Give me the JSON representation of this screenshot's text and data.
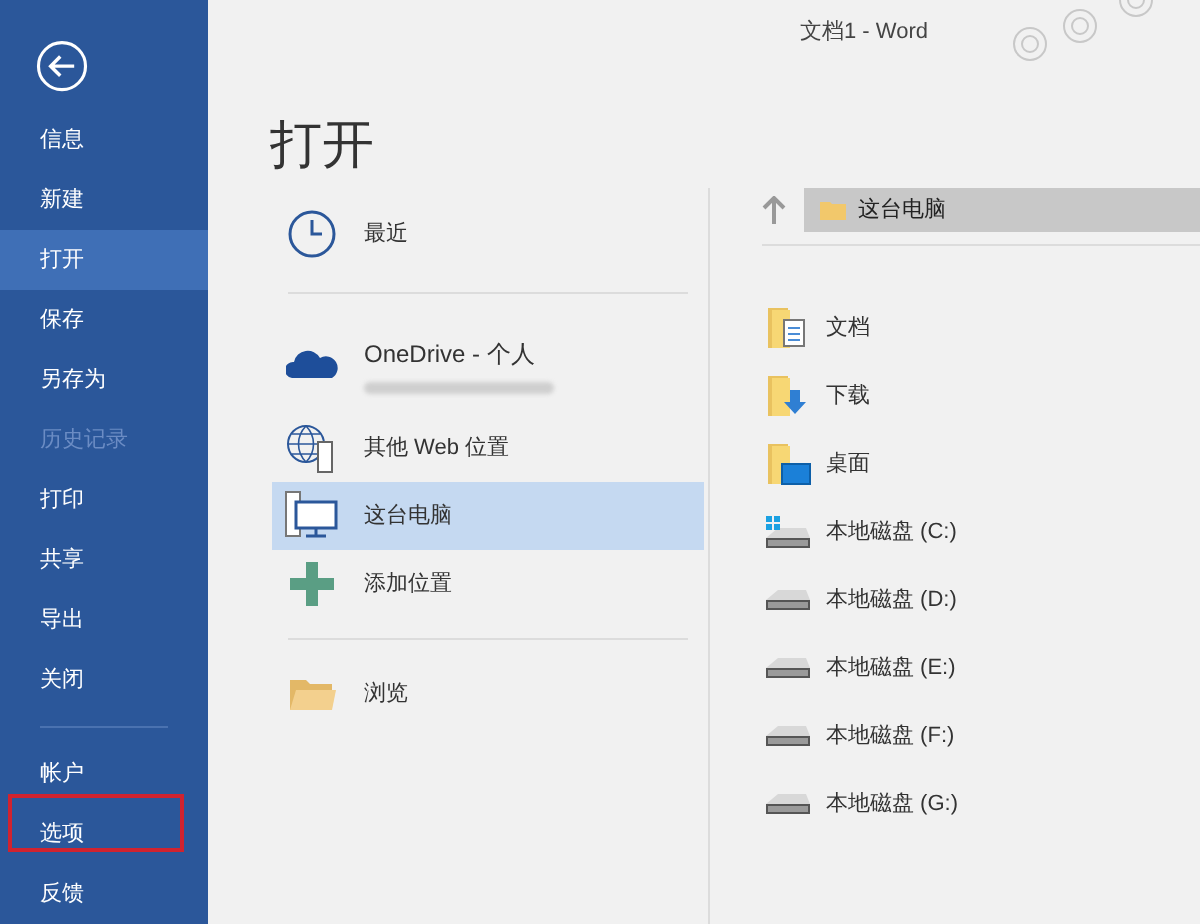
{
  "window": {
    "title": "文档1 - Word"
  },
  "sidebar": {
    "items": [
      {
        "label": "信息",
        "selected": false,
        "disabled": false,
        "outlined": false
      },
      {
        "label": "新建",
        "selected": false,
        "disabled": false,
        "outlined": false
      },
      {
        "label": "打开",
        "selected": true,
        "disabled": false,
        "outlined": false
      },
      {
        "label": "保存",
        "selected": false,
        "disabled": false,
        "outlined": false
      },
      {
        "label": "另存为",
        "selected": false,
        "disabled": false,
        "outlined": false
      },
      {
        "label": "历史记录",
        "selected": false,
        "disabled": true,
        "outlined": false
      },
      {
        "label": "打印",
        "selected": false,
        "disabled": false,
        "outlined": false
      },
      {
        "label": "共享",
        "selected": false,
        "disabled": false,
        "outlined": false
      },
      {
        "label": "导出",
        "selected": false,
        "disabled": false,
        "outlined": false
      },
      {
        "label": "关闭",
        "selected": false,
        "disabled": false,
        "outlined": false
      }
    ],
    "bottom_items": [
      {
        "label": "帐户",
        "selected": false,
        "disabled": false,
        "outlined": false
      },
      {
        "label": "选项",
        "selected": false,
        "disabled": false,
        "outlined": true
      },
      {
        "label": "反馈",
        "selected": false,
        "disabled": false,
        "outlined": false
      }
    ]
  },
  "heading": "打开",
  "places": [
    {
      "kind": "recent",
      "label": "最近",
      "selected": false,
      "divider_after": true
    },
    {
      "kind": "cloud",
      "label": "OneDrive - 个人",
      "selected": false,
      "redacted_account": true,
      "divider_after": false
    },
    {
      "kind": "web",
      "label": "其他 Web 位置",
      "selected": false,
      "divider_after": false
    },
    {
      "kind": "computer",
      "label": "这台电脑",
      "selected": true,
      "divider_after": false
    },
    {
      "kind": "add",
      "label": "添加位置",
      "selected": false,
      "divider_after": true
    },
    {
      "kind": "browse",
      "label": "浏览",
      "selected": false,
      "divider_after": false
    }
  ],
  "breadcrumb": {
    "label": "这台电脑"
  },
  "folders": [
    {
      "kind": "documents",
      "label": "文档"
    },
    {
      "kind": "downloads",
      "label": "下载"
    },
    {
      "kind": "desktop",
      "label": "桌面"
    },
    {
      "kind": "system_drive",
      "label": "本地磁盘 (C:)"
    },
    {
      "kind": "drive",
      "label": "本地磁盘 (D:)"
    },
    {
      "kind": "drive",
      "label": "本地磁盘 (E:)"
    },
    {
      "kind": "drive",
      "label": "本地磁盘 (F:)"
    },
    {
      "kind": "drive",
      "label": "本地磁盘 (G:)"
    }
  ]
}
